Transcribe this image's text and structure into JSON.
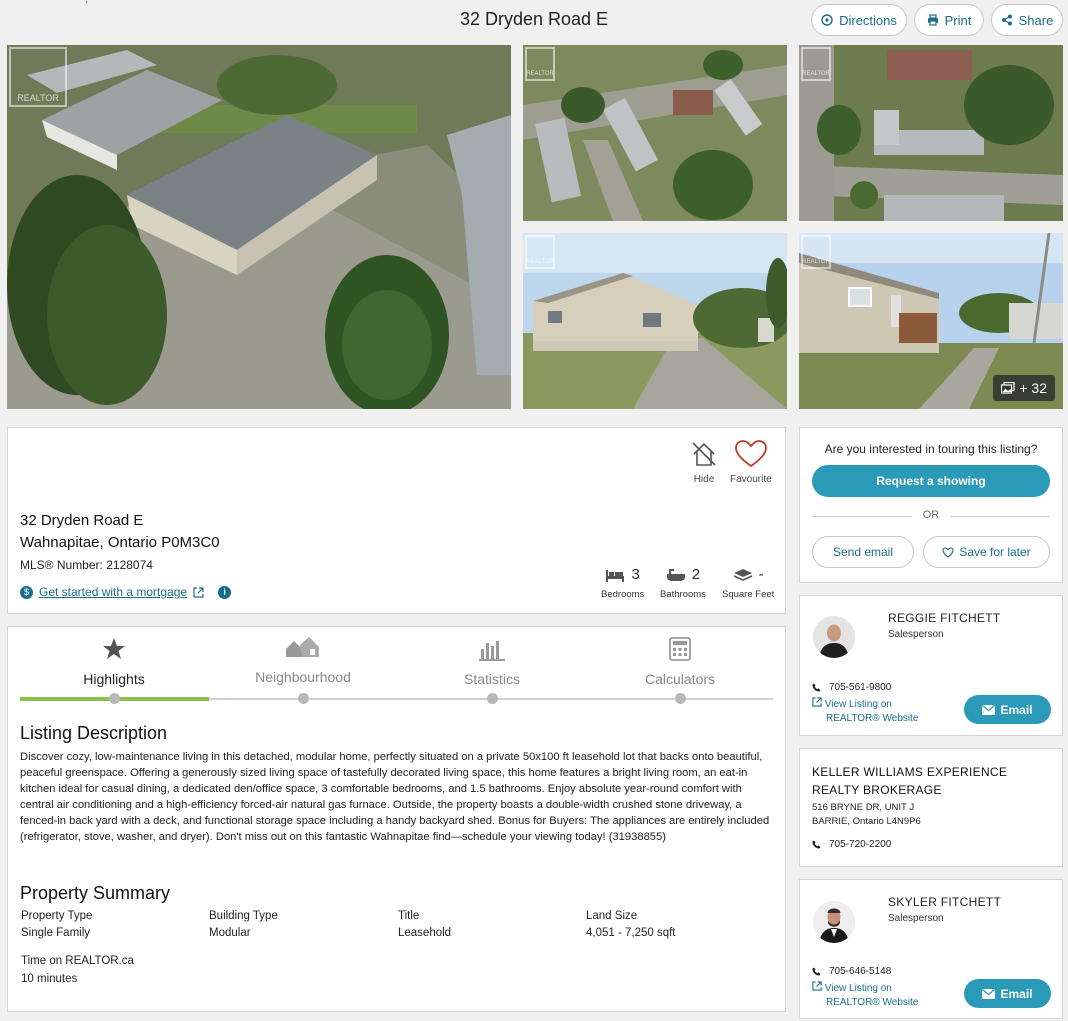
{
  "header": {
    "breadcrumb": "• • • • • • • • • ,",
    "title": "32 Dryden Road E",
    "buttons": {
      "directions": "Directions",
      "print": "Print",
      "share": "Share"
    }
  },
  "photos": {
    "watermark": "REALTOR",
    "more_count": "+ 32"
  },
  "listing": {
    "address_line1": "32 Dryden Road E",
    "address_line2": "Wahnapitae, Ontario P0M3C0",
    "mls_label": "MLS® Number:",
    "mls_number": "2128074",
    "mortgage_link": "Get started with a mortgage",
    "hide_label": "Hide",
    "favourite_label": "Favourite",
    "bedrooms": {
      "value": "3",
      "label": "Bedrooms"
    },
    "bathrooms": {
      "value": "2",
      "label": "Bathrooms"
    },
    "square_feet": {
      "value": "-",
      "label": "Square Feet"
    }
  },
  "tabs": [
    {
      "label": "Highlights",
      "active": true
    },
    {
      "label": "Neighbourhood"
    },
    {
      "label": "Statistics"
    },
    {
      "label": "Calculators"
    }
  ],
  "description": {
    "heading": "Listing Description",
    "text": "Discover cozy, low-maintenance living in this detached, modular home, perfectly situated on a private 50x100 ft leasehold lot that backs onto beautiful, peaceful greenspace. Offering a generously sized living space of tastefully decorated living space, this home features a bright living room, an eat-in kitchen ideal for casual dining, a dedicated den/office space, 3 comfortable bedrooms, and 1.5 bathrooms. Enjoy absolute year-round comfort with central air conditioning and a high-efficiency forced-air natural gas furnace. Outside, the property boasts a double-width crushed stone driveway, a fenced-in back yard with a deck, and functional storage space including a handy backyard shed. Bonus for Buyers: The appliances are entirely included (refrigerator, stove, washer, and dryer). Don't miss out on this fantastic Wahnapitae find—schedule your viewing today! (31938855)"
  },
  "property_summary": {
    "heading": "Property Summary",
    "property_type": {
      "label": "Property Type",
      "value": "Single Family"
    },
    "building_type": {
      "label": "Building Type",
      "value": "Modular"
    },
    "title": {
      "label": "Title",
      "value": "Leasehold"
    },
    "land_size": {
      "label": "Land Size",
      "value": "4,051 - 7,250 sqft"
    },
    "time_on": {
      "label": "Time on REALTOR.ca",
      "value": "10 minutes"
    }
  },
  "tour": {
    "question": "Are you interested in touring this listing?",
    "request_button": "Request a showing",
    "or": "OR",
    "send_email": "Send email",
    "save_later": "Save for later"
  },
  "agents": [
    {
      "name": "REGGIE FITCHETT",
      "role": "Salesperson",
      "phone": "705-561-9800",
      "view_link_1": "View Listing on",
      "view_link_2": "REALTOR® Website",
      "email_button": "Email"
    },
    {
      "name": "SKYLER FITCHETT",
      "role": "Salesperson",
      "phone": "705-646-5148",
      "view_link_1": "View Listing on",
      "view_link_2": "REALTOR® Website",
      "email_button": "Email"
    }
  ],
  "brokerage": {
    "name_line1": "KELLER WILLIAMS EXPERIENCE",
    "name_line2": "REALTY BROKERAGE",
    "address_line1": "516 BRYNE DR, UNIT J",
    "address_line2": "BARRIE, Ontario L4N9P6",
    "phone": "705-720-2200"
  },
  "colors": {
    "accent": "#2a9ab8",
    "link": "#1a6e8a",
    "tab_active": "#8cc04a",
    "favourite": "#c0392b"
  }
}
